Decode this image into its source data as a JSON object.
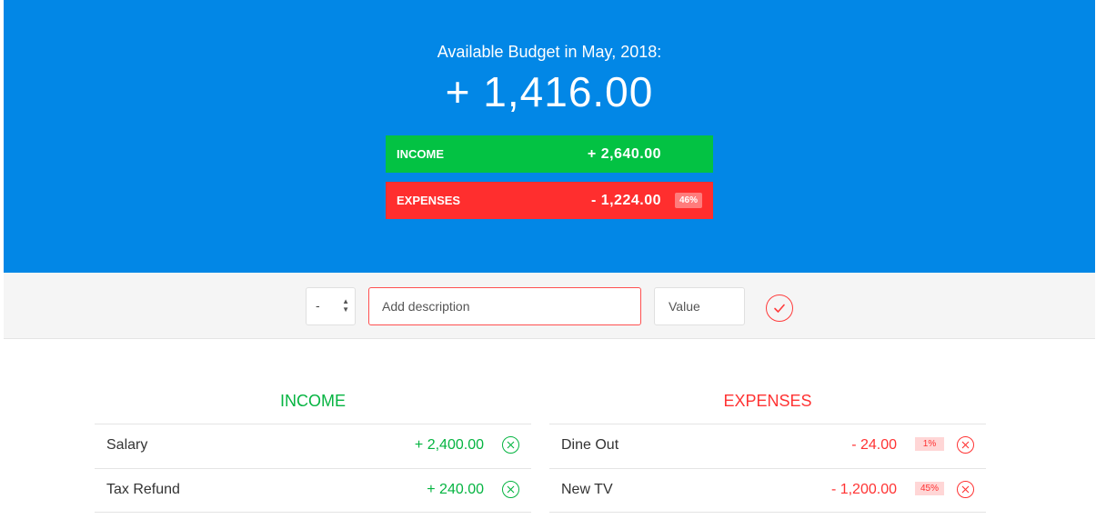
{
  "header": {
    "title": "Available Budget in May, 2018:",
    "budget": "+ 1,416.00",
    "income": {
      "label": "INCOME",
      "value": "+ 2,640.00"
    },
    "expenses": {
      "label": "EXPENSES",
      "value": "- 1,224.00",
      "percentage": "46%"
    }
  },
  "add_form": {
    "type_selected": "-",
    "description_placeholder": "Add description",
    "value_placeholder": "Value",
    "submit_icon": "check-circle-icon"
  },
  "income": {
    "title": "INCOME",
    "items": [
      {
        "description": "Salary",
        "value": "+ 2,400.00"
      },
      {
        "description": "Tax Refund",
        "value": "+ 240.00"
      }
    ]
  },
  "expenses": {
    "title": "EXPENSES",
    "items": [
      {
        "description": "Dine Out",
        "value": "- 24.00",
        "percentage": "1%"
      },
      {
        "description": "New TV",
        "value": "- 1,200.00",
        "percentage": "45%"
      }
    ]
  },
  "colors": {
    "header_bg": "#0287e6",
    "income": "#03c243",
    "expenses": "#ff2e2e"
  }
}
